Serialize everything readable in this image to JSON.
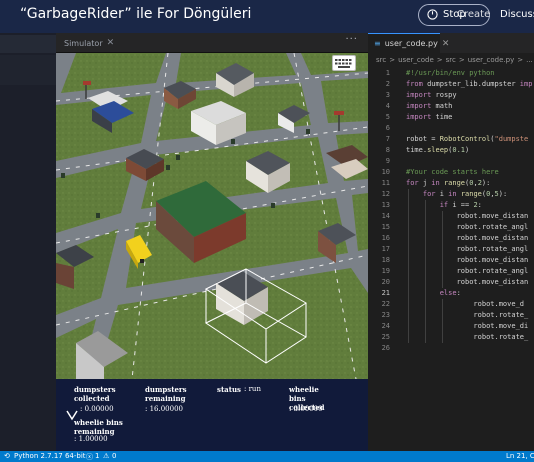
{
  "header": {
    "title": "“GarbageRider” ile For Döngüleri",
    "stop_label": "Stop",
    "stop_overlay_label": "Create",
    "discuss_label": "Discuss"
  },
  "simulator": {
    "tab_label": "Simulator",
    "more_label": "···",
    "stats": {
      "dumpsters_collected_label": "dumpsters collected",
      "dumpsters_collected_value": ": 0.00000",
      "dumpsters_remaining_label": "dumpsters remaining",
      "dumpsters_remaining_value": ": 16.00000",
      "status_label": "status",
      "status_value": ": run",
      "wheelie_collected_label": "wheelie bins collected",
      "wheelie_collected_value": ": 3.00000",
      "wheelie_remaining_label": "wheelie bins remaining",
      "wheelie_remaining_value": ": 1.00000"
    }
  },
  "editor": {
    "tab_label": "user_code.py",
    "breadcrumb": [
      "src",
      ">",
      "user_code",
      ">",
      "src",
      ">",
      "user_code.py",
      ">",
      "..."
    ],
    "active_line": 21,
    "lines": [
      {
        "n": 1,
        "parts": [
          [
            "cm",
            "#!/usr/bin/env python"
          ]
        ]
      },
      {
        "n": 2,
        "parts": [
          [
            "kw",
            "from "
          ],
          [
            "",
            "dumpster_lib.dumpster "
          ],
          [
            "kw",
            "imp"
          ]
        ]
      },
      {
        "n": 3,
        "parts": [
          [
            "kw",
            "import "
          ],
          [
            "",
            "rospy"
          ]
        ]
      },
      {
        "n": 4,
        "parts": [
          [
            "kw",
            "import "
          ],
          [
            "",
            "math"
          ]
        ]
      },
      {
        "n": 5,
        "parts": [
          [
            "kw",
            "import "
          ],
          [
            "",
            "time"
          ]
        ]
      },
      {
        "n": 6,
        "parts": []
      },
      {
        "n": 7,
        "parts": [
          [
            "",
            "robot = "
          ],
          [
            "fn",
            "RobotControl"
          ],
          [
            "",
            "("
          ],
          [
            "str",
            "\"dumpste"
          ]
        ]
      },
      {
        "n": 8,
        "parts": [
          [
            "",
            "time."
          ],
          [
            "fn",
            "sleep"
          ],
          [
            "",
            "("
          ],
          [
            "num",
            "0.1"
          ],
          [
            "",
            ")"
          ]
        ]
      },
      {
        "n": 9,
        "parts": []
      },
      {
        "n": 10,
        "parts": [
          [
            "cm",
            "#Your code starts here"
          ]
        ]
      },
      {
        "n": 11,
        "parts": [
          [
            "kw",
            "for "
          ],
          [
            "",
            "j "
          ],
          [
            "kw",
            "in "
          ],
          [
            "fn",
            "range"
          ],
          [
            "",
            "("
          ],
          [
            "num",
            "0"
          ],
          [
            "",
            ","
          ],
          [
            "num",
            "2"
          ],
          [
            "",
            "):"
          ]
        ]
      },
      {
        "n": 12,
        "parts": [
          [
            "",
            "    "
          ],
          [
            "kw",
            "for "
          ],
          [
            "",
            "i "
          ],
          [
            "kw",
            "in "
          ],
          [
            "fn",
            "range"
          ],
          [
            "",
            "("
          ],
          [
            "num",
            "0"
          ],
          [
            "",
            ","
          ],
          [
            "num",
            "5"
          ],
          [
            "",
            "):"
          ]
        ]
      },
      {
        "n": 13,
        "parts": [
          [
            "",
            "        "
          ],
          [
            "kw",
            "if "
          ],
          [
            "",
            "i == "
          ],
          [
            "num",
            "2"
          ],
          [
            "",
            ":"
          ]
        ]
      },
      {
        "n": 14,
        "parts": [
          [
            "",
            "            robot.move_distan"
          ]
        ]
      },
      {
        "n": 15,
        "parts": [
          [
            "",
            "            robot.rotate_angl"
          ]
        ]
      },
      {
        "n": 16,
        "parts": [
          [
            "",
            "            robot.move_distan"
          ]
        ]
      },
      {
        "n": 17,
        "parts": [
          [
            "",
            "            robot.rotate_angl"
          ]
        ]
      },
      {
        "n": 18,
        "parts": [
          [
            "",
            "            robot.move_distan"
          ]
        ]
      },
      {
        "n": 19,
        "parts": [
          [
            "",
            "            robot.rotate_angl"
          ]
        ]
      },
      {
        "n": 20,
        "parts": [
          [
            "",
            "            robot.move_distan"
          ]
        ]
      },
      {
        "n": 21,
        "parts": [
          [
            "",
            "        "
          ],
          [
            "kw",
            "else"
          ],
          [
            "",
            ":"
          ]
        ]
      },
      {
        "n": 22,
        "parts": [
          [
            "",
            "                robot.move_d"
          ]
        ]
      },
      {
        "n": 23,
        "parts": [
          [
            "",
            "                robot.rotate_"
          ]
        ]
      },
      {
        "n": 24,
        "parts": [
          [
            "",
            "                robot.move_di"
          ]
        ]
      },
      {
        "n": 25,
        "parts": [
          [
            "",
            "                robot.rotate_"
          ]
        ]
      },
      {
        "n": 26,
        "parts": []
      }
    ]
  },
  "statusbar": {
    "python_label": "Python 2.7.17 64-bit",
    "errors_label": "1",
    "warnings_label": "0",
    "position_label": "Ln 21, Co"
  },
  "colors": {
    "header_bg": "#1a2747",
    "status_bg": "#007acc",
    "editor_bg": "#1e1e1e",
    "hud_bg": "#111a3a",
    "road": "#7f8286",
    "grass": "#5f7d3a"
  },
  "icons": [
    "stop-icon",
    "keyboard-icon",
    "python-file-icon",
    "error-icon",
    "warning-icon",
    "sync-icon",
    "close-icon"
  ]
}
